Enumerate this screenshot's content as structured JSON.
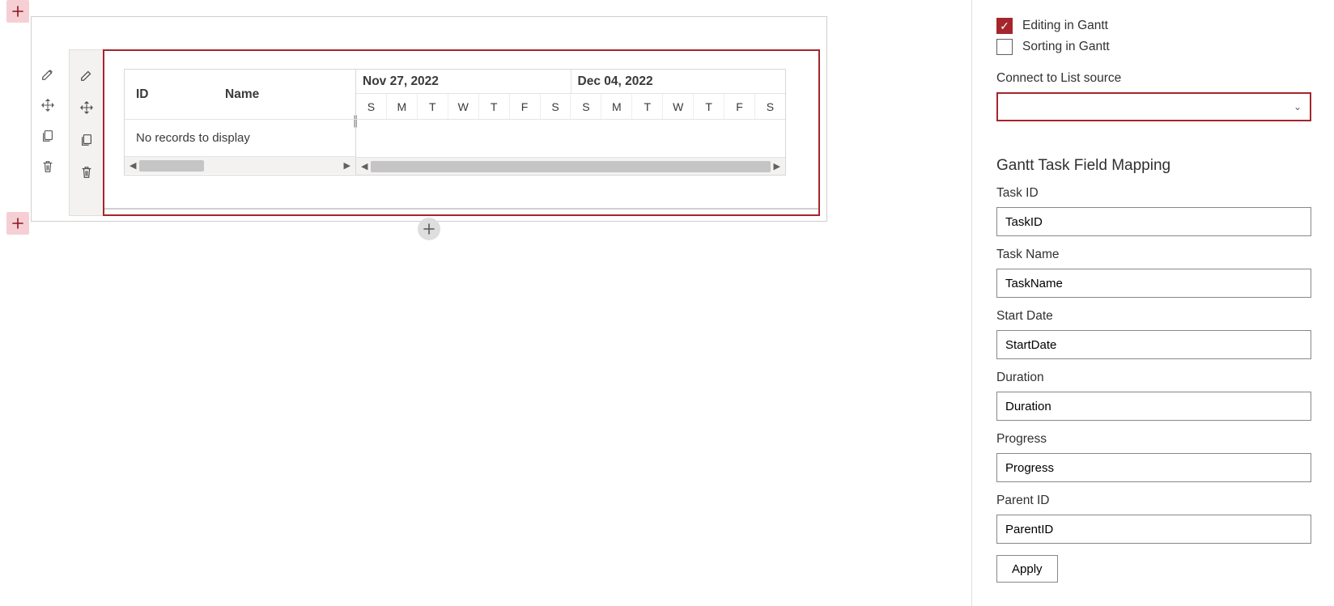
{
  "canvas": {
    "outer_toolbar": {
      "edit_icon": "edit",
      "move_icon": "move",
      "duplicate_icon": "duplicate",
      "delete_icon": "delete"
    },
    "inner_toolbar": {
      "edit_icon": "edit",
      "move_icon": "move",
      "duplicate_icon": "duplicate",
      "delete_icon": "delete"
    }
  },
  "gantt": {
    "columns": {
      "id": "ID",
      "name": "Name"
    },
    "empty_message": "No records to display",
    "weeks": [
      {
        "label": "Nov 27, 2022",
        "days": [
          "S",
          "M",
          "T",
          "W",
          "T",
          "F",
          "S"
        ]
      },
      {
        "label": "Dec 04, 2022",
        "days": [
          "S",
          "M",
          "T",
          "W",
          "T",
          "F",
          "S"
        ]
      }
    ]
  },
  "panel": {
    "checkboxes": {
      "editing": {
        "label": "Editing in Gantt",
        "checked": true
      },
      "sorting": {
        "label": "Sorting in Gantt",
        "checked": false
      }
    },
    "connect_source_label": "Connect to List source",
    "connect_source_value": "",
    "mapping_heading": "Gantt Task Field Mapping",
    "fields": {
      "task_id": {
        "label": "Task ID",
        "value": "TaskID"
      },
      "task_name": {
        "label": "Task Name",
        "value": "TaskName"
      },
      "start_date": {
        "label": "Start Date",
        "value": "StartDate"
      },
      "duration": {
        "label": "Duration",
        "value": "Duration"
      },
      "progress": {
        "label": "Progress",
        "value": "Progress"
      },
      "parent_id": {
        "label": "Parent ID",
        "value": "ParentID"
      }
    },
    "apply_label": "Apply"
  }
}
